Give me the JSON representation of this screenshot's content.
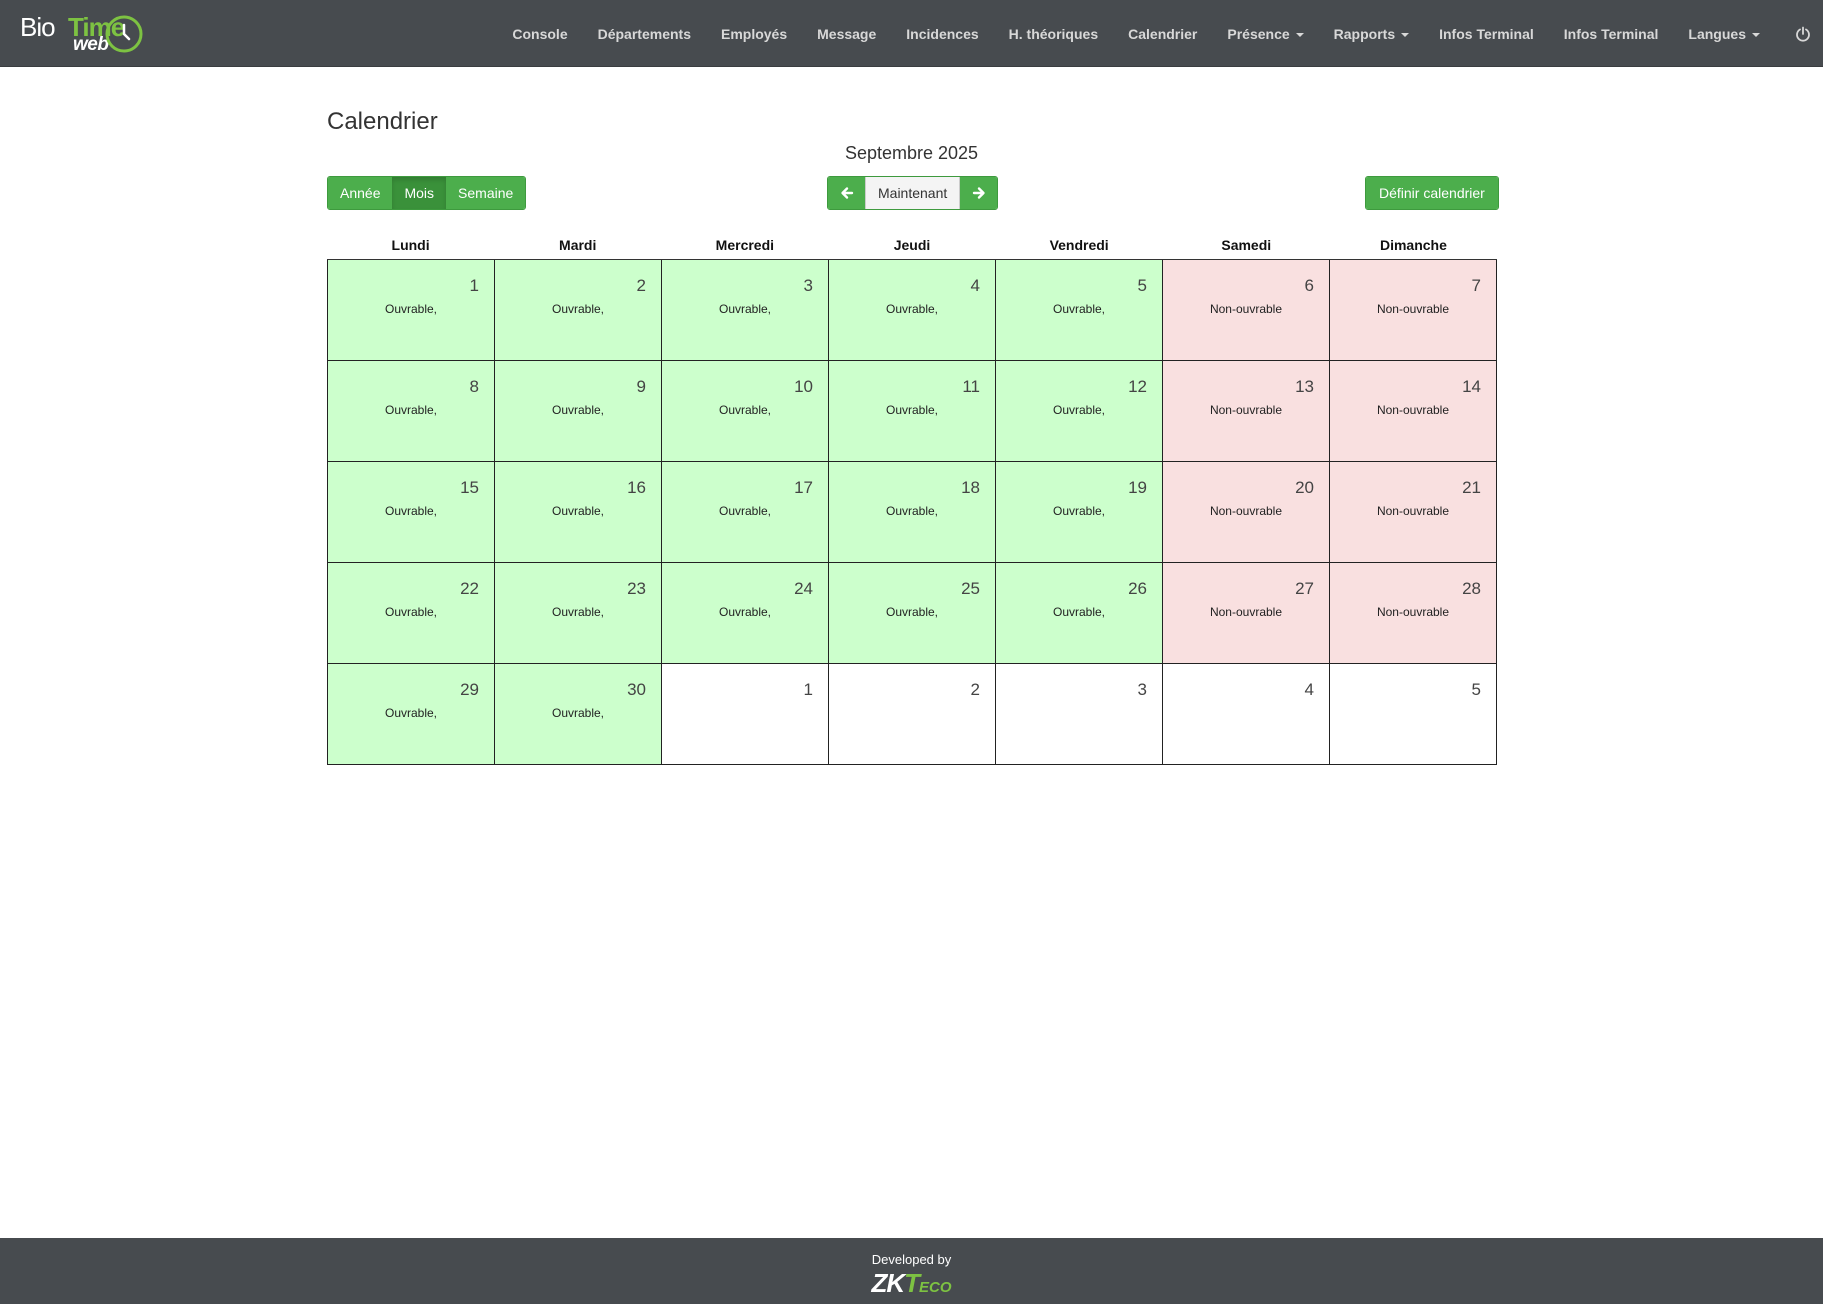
{
  "brand": {
    "bio": "Bio",
    "time": "Time",
    "web": "web"
  },
  "nav": {
    "items": [
      {
        "label": "Console",
        "dropdown": false
      },
      {
        "label": "Départements",
        "dropdown": false
      },
      {
        "label": "Employés",
        "dropdown": false
      },
      {
        "label": "Message",
        "dropdown": false
      },
      {
        "label": "Incidences",
        "dropdown": false
      },
      {
        "label": "H. théoriques",
        "dropdown": false
      },
      {
        "label": "Calendrier",
        "dropdown": false
      },
      {
        "label": "Présence",
        "dropdown": true
      },
      {
        "label": "Rapports",
        "dropdown": true
      },
      {
        "label": "Infos Terminal",
        "dropdown": false
      },
      {
        "label": "Infos Terminal",
        "dropdown": false
      },
      {
        "label": "Langues",
        "dropdown": true
      }
    ],
    "power_icon": "power-icon"
  },
  "page": {
    "title": "Calendrier",
    "period": "Septembre 2025"
  },
  "views": {
    "year": "Année",
    "month": "Mois",
    "week": "Semaine",
    "active": "month"
  },
  "navigation": {
    "today": "Maintenant",
    "prev_icon": "arrow-left-icon",
    "next_icon": "arrow-right-icon"
  },
  "actions": {
    "define": "Définir calendrier"
  },
  "calendar": {
    "weekdays": [
      "Lundi",
      "Mardi",
      "Mercredi",
      "Jeudi",
      "Vendredi",
      "Samedi",
      "Dimanche"
    ],
    "days": [
      {
        "day": "1",
        "label": "Ouvrable,",
        "type": "workday"
      },
      {
        "day": "2",
        "label": "Ouvrable,",
        "type": "workday"
      },
      {
        "day": "3",
        "label": "Ouvrable,",
        "type": "workday"
      },
      {
        "day": "4",
        "label": "Ouvrable,",
        "type": "workday"
      },
      {
        "day": "5",
        "label": "Ouvrable,",
        "type": "workday"
      },
      {
        "day": "6",
        "label": "Non-ouvrable",
        "type": "weekend"
      },
      {
        "day": "7",
        "label": "Non-ouvrable",
        "type": "weekend"
      },
      {
        "day": "8",
        "label": "Ouvrable,",
        "type": "workday"
      },
      {
        "day": "9",
        "label": "Ouvrable,",
        "type": "workday"
      },
      {
        "day": "10",
        "label": "Ouvrable,",
        "type": "workday"
      },
      {
        "day": "11",
        "label": "Ouvrable,",
        "type": "workday"
      },
      {
        "day": "12",
        "label": "Ouvrable,",
        "type": "workday"
      },
      {
        "day": "13",
        "label": "Non-ouvrable",
        "type": "weekend"
      },
      {
        "day": "14",
        "label": "Non-ouvrable",
        "type": "weekend"
      },
      {
        "day": "15",
        "label": "Ouvrable,",
        "type": "workday"
      },
      {
        "day": "16",
        "label": "Ouvrable,",
        "type": "workday"
      },
      {
        "day": "17",
        "label": "Ouvrable,",
        "type": "workday"
      },
      {
        "day": "18",
        "label": "Ouvrable,",
        "type": "workday"
      },
      {
        "day": "19",
        "label": "Ouvrable,",
        "type": "workday"
      },
      {
        "day": "20",
        "label": "Non-ouvrable",
        "type": "weekend"
      },
      {
        "day": "21",
        "label": "Non-ouvrable",
        "type": "weekend"
      },
      {
        "day": "22",
        "label": "Ouvrable,",
        "type": "workday"
      },
      {
        "day": "23",
        "label": "Ouvrable,",
        "type": "workday"
      },
      {
        "day": "24",
        "label": "Ouvrable,",
        "type": "workday"
      },
      {
        "day": "25",
        "label": "Ouvrable,",
        "type": "workday"
      },
      {
        "day": "26",
        "label": "Ouvrable,",
        "type": "workday"
      },
      {
        "day": "27",
        "label": "Non-ouvrable",
        "type": "weekend"
      },
      {
        "day": "28",
        "label": "Non-ouvrable",
        "type": "weekend"
      },
      {
        "day": "29",
        "label": "Ouvrable,",
        "type": "workday"
      },
      {
        "day": "30",
        "label": "Ouvrable,",
        "type": "workday"
      },
      {
        "day": "1",
        "label": "",
        "type": "empty"
      },
      {
        "day": "2",
        "label": "",
        "type": "empty"
      },
      {
        "day": "3",
        "label": "",
        "type": "empty"
      },
      {
        "day": "4",
        "label": "",
        "type": "empty"
      },
      {
        "day": "5",
        "label": "",
        "type": "empty"
      }
    ]
  },
  "footer": {
    "developed_by": "Developed by",
    "zk": "ZK",
    "t": "T",
    "eco": "ECO"
  },
  "colors": {
    "navbar": "#474b4f",
    "accent": "#4cae4c",
    "workday": "#ccffcc",
    "weekend": "#f9e0e0"
  }
}
